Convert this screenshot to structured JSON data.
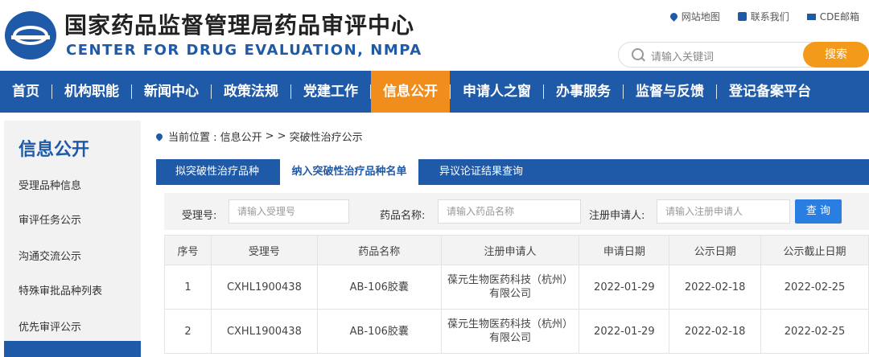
{
  "header": {
    "title_cn": "国家药品监督管理局药品审评中心",
    "title_en": "CENTER FOR DRUG EVALUATION, NMPA",
    "links": {
      "sitemap": "网站地图",
      "contact": "联系我们",
      "mail": "CDE邮箱"
    },
    "search": {
      "placeholder": "请输入关键词",
      "button": "搜索"
    }
  },
  "nav": {
    "items": [
      "首页",
      "机构职能",
      "新闻中心",
      "政策法规",
      "党建工作",
      "信息公开",
      "申请人之窗",
      "办事服务",
      "监督与反馈",
      "登记备案平台"
    ],
    "active_index": 5
  },
  "sidebar": {
    "title": "信息公开",
    "items": [
      "受理品种信息",
      "审评任务公示",
      "沟通交流公示",
      "特殊审批品种列表",
      "优先审评公示"
    ]
  },
  "breadcrumb": {
    "prefix": "当前位置 : 信息公开",
    "sep": "> >",
    "current": "突破性治疗公示"
  },
  "tabs": [
    "拟突破性治疗品种",
    "纳入突破性治疗品种名单",
    "异议论证结果查询"
  ],
  "filter": {
    "accept_label": "受理号:",
    "accept_placeholder": "请输入受理号",
    "drug_label": "药品名称:",
    "drug_placeholder": "请输入药品名称",
    "applicant_label": "注册申请人:",
    "applicant_placeholder": "请输入注册申请人",
    "button": "查 询"
  },
  "table": {
    "headers": [
      "序号",
      "受理号",
      "药品名称",
      "注册申请人",
      "申请日期",
      "公示日期",
      "公示截止日期"
    ],
    "rows": [
      [
        "1",
        "CXHL1900438",
        "AB-106胶囊",
        "葆元生物医药科技（杭州）有限公司",
        "2022-01-29",
        "2022-02-18",
        "2022-02-25"
      ],
      [
        "2",
        "CXHL1900438",
        "AB-106胶囊",
        "葆元生物医药科技（杭州）有限公司",
        "2022-01-29",
        "2022-02-18",
        "2022-02-25"
      ]
    ]
  },
  "colors": {
    "brand_blue": "#1f5aa8",
    "accent_orange": "#f08d1d",
    "query_blue": "#2a7de1"
  }
}
